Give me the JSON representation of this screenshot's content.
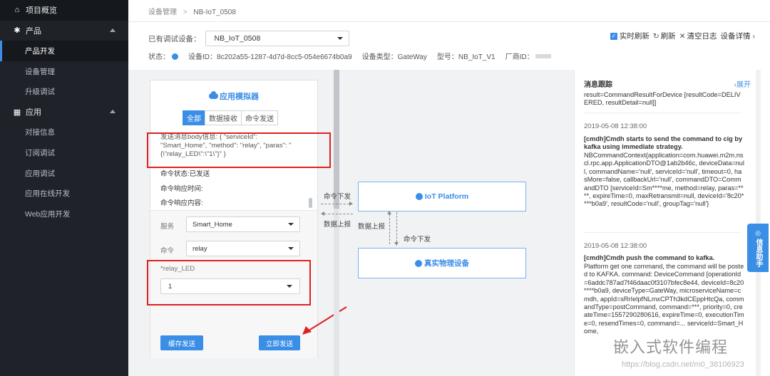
{
  "sidebar": {
    "items": [
      {
        "label": "项目概览",
        "type": "top",
        "icon": "home-icon"
      },
      {
        "label": "产品",
        "type": "top",
        "icon": "gear-icon",
        "expanded": true
      },
      {
        "label": "产品开发",
        "type": "sub",
        "active": true
      },
      {
        "label": "设备管理",
        "type": "sub"
      },
      {
        "label": "升级调试",
        "type": "sub"
      },
      {
        "label": "应用",
        "type": "top",
        "icon": "grid-icon",
        "expanded": true
      },
      {
        "label": "对接信息",
        "type": "sub"
      },
      {
        "label": "订阅调试",
        "type": "sub"
      },
      {
        "label": "应用调试",
        "type": "sub"
      },
      {
        "label": "应用在线开发",
        "type": "sub"
      },
      {
        "label": "Web应用开发",
        "type": "sub"
      }
    ]
  },
  "breadcrumb": {
    "parent": "设备管理",
    "separator": ">",
    "current": "NB-IoT_0508"
  },
  "device_select": {
    "label": "已有调试设备：",
    "value": "NB_IoT_0508"
  },
  "tools": {
    "realtime": "实时刷新",
    "refresh": "刷新",
    "clear_log": "清空日志",
    "details": "设备详情"
  },
  "info": {
    "status_label": "状态：",
    "device_id": "设备ID：8c202a55-1287-4d7d-8cc5-054e6674b0a9",
    "device_type": "设备类型：GateWay",
    "model": "型号：NB_IoT_V1",
    "vendor": "厂商ID："
  },
  "simulator": {
    "title": "应用模拟器",
    "tabs": [
      "全部",
      "数据接收",
      "命令发送"
    ],
    "message": "发送消息body信息: { \"serviceId\": \"Smart_Home\", \"method\": \"relay\", \"paras\": \"{\\\"relay_LED\\\":\\\"1\\\"}\" }",
    "cmd_status": "命令状态:已发送",
    "cmd_resp_time": "命令响应时间:",
    "cmd_resp_content": "命令响应内容:",
    "service_label": "服务",
    "service_value": "Smart_Home",
    "command_label": "命令",
    "command_value": "relay",
    "param_label": "*relay_LED",
    "param_value": "1",
    "btn_cache": "缓存发送",
    "btn_now": "立即发送"
  },
  "flow": {
    "cmd_down_1": "命令下发",
    "data_up_1": "数据上报",
    "data_up_2": "数据上报",
    "cmd_down_2": "命令下发",
    "platform": "IoT Platform",
    "device": "真实物理设备"
  },
  "trace": {
    "title": "消息跟踪",
    "expand": "展开",
    "top_text": "result=CommandResultForDevice [resultCode=DELIVERED, resultDetail=null]]",
    "entries": [
      {
        "time": "2019-05-08 12:38:00",
        "headline": "[cmdh]Cmdh starts to send the command to cig by kafka using immediate strategy.",
        "body": "NBCommandContext{application=com.huawei.m2m.nscl.rpc.app.ApplicationDTO@1ab2b46c, deviceData=null, commandName='null', serviceId='null', timeout=0, hasMore=false, callbackUrl='null', commandDTO=CommandDTO [serviceId=Sm****me, method=relay, paras=****, expireTime=0, maxRetransmit=null, deviceId='8c20****b0a9', resultCode='null', groupTag='null'}"
      },
      {
        "time": "2019-05-08 12:38:00",
        "headline": "[cmdh]Cmdh push the command to kafka.",
        "body": "Platform get one command, the command will be posted to KAFKA. command: DeviceCommand [operationId=6addc787ad7f46daac0f3107bfec8e44, deviceId=8c20****b0a9, deviceType=GateWay, microserviceName=cmdh, appId=sRrIelpfNLmxCPTh3kdCEppHtcQa, commandType=postCommand, command=***, priority=0, createTime=1557290280616, expireTime=0, executionTime=0, resendTimes=0, command=... serviceId=Smart_Home,"
      }
    ]
  },
  "helper": {
    "label": "信息助手"
  },
  "watermark": {
    "text": "嵌入式软件编程",
    "url": "https://blog.csdn.net/m0_38106923"
  },
  "colors": {
    "accent": "#3a8ee6",
    "sidebar_bg": "#1f2329",
    "highlight": "#e02020"
  }
}
